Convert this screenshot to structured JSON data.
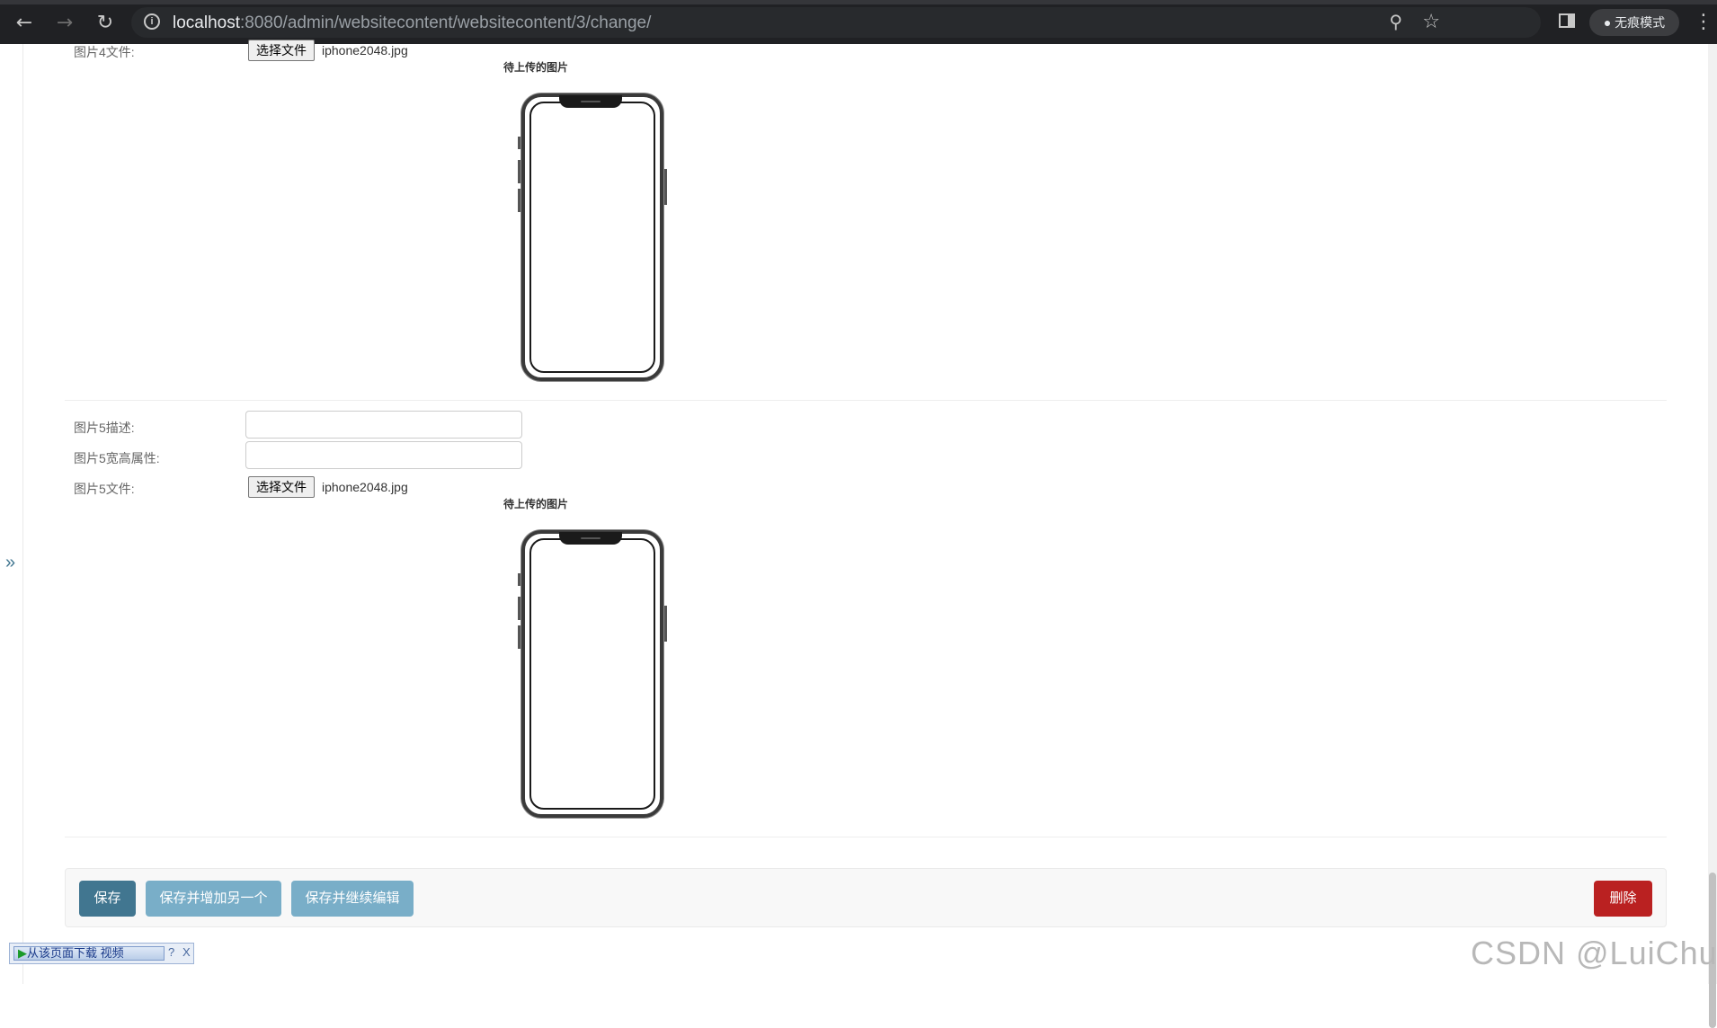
{
  "browser": {
    "url_host": "localhost",
    "url_rest": ":8080/admin/websitecontent/websitecontent/3/change/",
    "incognito_label": "无痕模式"
  },
  "fields": {
    "image4_file_label": "图片4文件:",
    "image5_desc_label": "图片5描述:",
    "image5_size_label": "图片5宽高属性:",
    "image5_file_label": "图片5文件:",
    "choose_file": "选择文件",
    "image4_filename": "iphone2048.jpg",
    "image5_filename": "iphone2048.jpg",
    "image5_desc_value": "",
    "image5_size_value": "",
    "preview_caption": "待上传的图片"
  },
  "submit": {
    "save": "保存",
    "save_add_another": "保存并增加另一个",
    "save_continue": "保存并继续编辑",
    "delete": "删除"
  },
  "download_bar": {
    "label": "从该页面下载 视频",
    "help": "?",
    "close": "X"
  },
  "watermark": "CSDN @LuiChun",
  "icons": {
    "back": "back-arrow-icon",
    "forward": "forward-arrow-icon",
    "reload": "reload-icon",
    "expand_sidebar": "double-chevron-right-icon"
  }
}
